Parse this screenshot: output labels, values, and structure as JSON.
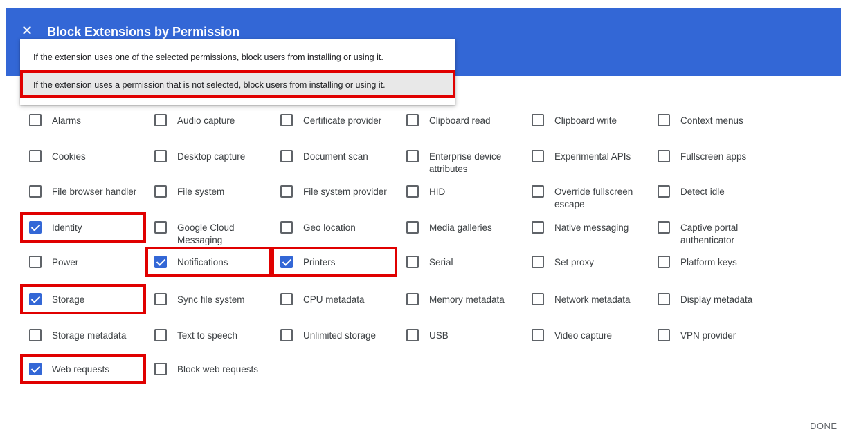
{
  "header": {
    "close_icon": "close-icon",
    "title": "Block Extensions by Permission",
    "accent_color": "#3367d6"
  },
  "dropdown": {
    "options": [
      "If the extension uses one of the selected permissions, block users from installing or using it.",
      "If the extension uses a permission that is not selected, block users from installing or using it."
    ],
    "selected_index": 1
  },
  "permissions": [
    {
      "label": "Alarms",
      "checked": false
    },
    {
      "label": "Audio capture",
      "checked": false
    },
    {
      "label": "Certificate provider",
      "checked": false
    },
    {
      "label": "Clipboard read",
      "checked": false
    },
    {
      "label": "Clipboard write",
      "checked": false
    },
    {
      "label": "Context menus",
      "checked": false
    },
    {
      "label": "Cookies",
      "checked": false
    },
    {
      "label": "Desktop capture",
      "checked": false
    },
    {
      "label": "Document scan",
      "checked": false
    },
    {
      "label": "Enterprise device attributes",
      "checked": false
    },
    {
      "label": "Experimental APIs",
      "checked": false
    },
    {
      "label": "Fullscreen apps",
      "checked": false
    },
    {
      "label": "File browser handler",
      "checked": false
    },
    {
      "label": "File system",
      "checked": false
    },
    {
      "label": "File system provider",
      "checked": false
    },
    {
      "label": "HID",
      "checked": false
    },
    {
      "label": "Override fullscreen escape",
      "checked": false
    },
    {
      "label": "Detect idle",
      "checked": false
    },
    {
      "label": "Identity",
      "checked": true
    },
    {
      "label": "Google Cloud Messaging",
      "checked": false
    },
    {
      "label": "Geo location",
      "checked": false
    },
    {
      "label": "Media galleries",
      "checked": false
    },
    {
      "label": "Native messaging",
      "checked": false
    },
    {
      "label": "Captive portal authenticator",
      "checked": false
    },
    {
      "label": "Power",
      "checked": false
    },
    {
      "label": "Notifications",
      "checked": true
    },
    {
      "label": "Printers",
      "checked": true
    },
    {
      "label": "Serial",
      "checked": false
    },
    {
      "label": "Set proxy",
      "checked": false
    },
    {
      "label": "Platform keys",
      "checked": false
    },
    {
      "label": "Storage",
      "checked": true
    },
    {
      "label": "Sync file system",
      "checked": false
    },
    {
      "label": "CPU metadata",
      "checked": false
    },
    {
      "label": "Memory metadata",
      "checked": false
    },
    {
      "label": "Network metadata",
      "checked": false
    },
    {
      "label": "Display metadata",
      "checked": false
    },
    {
      "label": "Storage metadata",
      "checked": false
    },
    {
      "label": "Text to speech",
      "checked": false
    },
    {
      "label": "Unlimited storage",
      "checked": false
    },
    {
      "label": "USB",
      "checked": false
    },
    {
      "label": "Video capture",
      "checked": false
    },
    {
      "label": "VPN provider",
      "checked": false
    },
    {
      "label": "Web requests",
      "checked": true
    },
    {
      "label": "Block web requests",
      "checked": false
    }
  ],
  "footer": {
    "done_label": "DONE"
  }
}
